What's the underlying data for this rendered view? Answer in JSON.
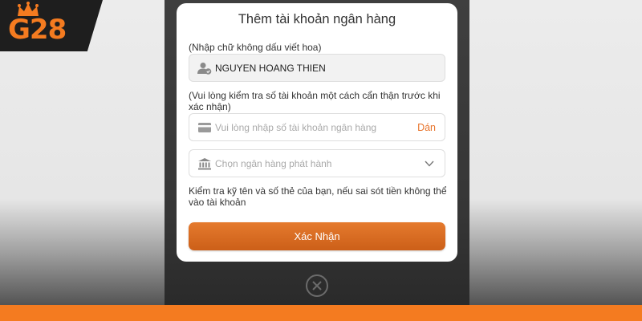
{
  "brand": {
    "logo_text": "G28",
    "logo_icon": "crown-icon",
    "accent_color": "#f47b20"
  },
  "modal": {
    "title": "Thêm tài khoản ngân hàng",
    "name_hint": "(Nhập chữ không dấu viết hoa)",
    "name_value": "NGUYEN HOANG THIEN",
    "name_icon": "user-verified-icon",
    "account_hint": "(Vui lòng kiểm tra số tài khoản một cách cẩn thận trước khi xác nhận)",
    "account_placeholder": "Vui lòng nhập số tài khoản ngân hàng",
    "account_icon": "card-icon",
    "paste_label": "Dán",
    "bank_placeholder": "Chọn ngân hàng phát hành",
    "bank_icon": "bank-icon",
    "warning": "Kiểm tra kỹ tên và số thẻ của bạn, nếu sai sót tiền không thể vào tài khoản",
    "submit_label": "Xác Nhận",
    "close_icon": "close-icon"
  }
}
